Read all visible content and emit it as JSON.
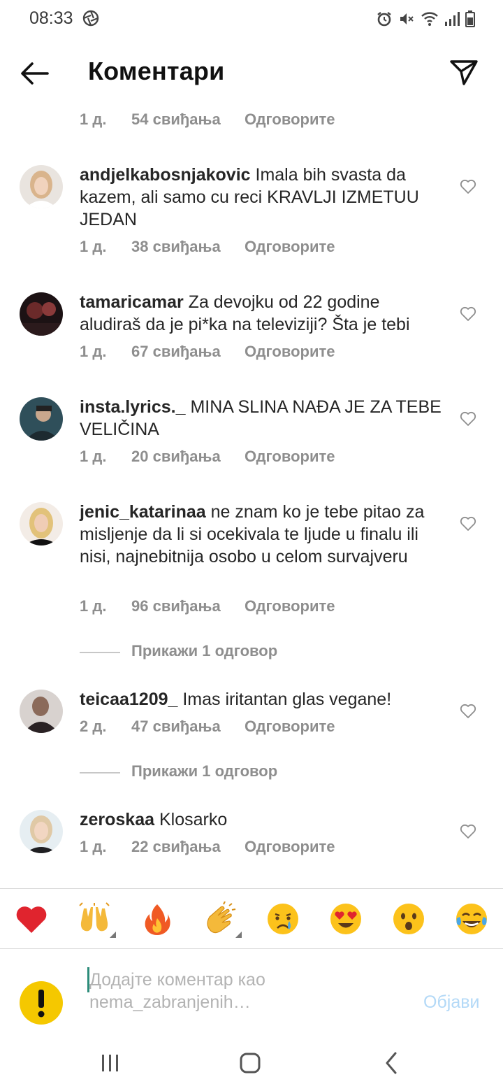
{
  "status_bar": {
    "time": "08:33",
    "left_icon": "aperture-icon",
    "right_icons": [
      "alarm-icon",
      "mute-icon",
      "wifi-icon",
      "signal-icon",
      "battery-icon"
    ]
  },
  "header": {
    "title": "Коментари",
    "back_icon": "back-arrow-icon",
    "share_icon": "paper-plane-icon"
  },
  "top_meta": {
    "time": "1 д.",
    "likes": "54 свиђања",
    "reply": "Одговорите"
  },
  "comments": [
    {
      "username": "andjelkabosnjakovic",
      "text": "Imala bih svasta da kazem, ali samo cu reci KRAVLJI IZMETUU JEDAN",
      "time": "1 д.",
      "likes": "38 свиђања",
      "reply": "Одговорите"
    },
    {
      "username": "tamaricamar",
      "text": "Za devojku od 22 godine aludiraš da je pi*ka na televiziji? Šta je tebi",
      "time": "1 д.",
      "likes": "67 свиђања",
      "reply": "Одговорите"
    },
    {
      "username": "insta.lyrics._",
      "text": "MINA SLINA NAĐA JE ZA TEBE VELIČINA",
      "time": "1 д.",
      "likes": "20 свиђања",
      "reply": "Одговорите"
    },
    {
      "username": "jenic_katarinaa",
      "text": "ne znam ko je tebe pitao za misljenje da li si ocekivala te ljude u finalu ili nisi, najnebitnija osobo u celom survajveru",
      "time": "1 д.",
      "likes": "96 свиђања",
      "reply": "Одговорите",
      "view_replies": "Прикажи 1 одговор"
    },
    {
      "username": "teicaa1209_",
      "text": "Imas iritantan glas vegane!",
      "time": "2 д.",
      "likes": "47 свиђања",
      "reply": "Одговорите",
      "view_replies": "Прикажи 1 одговор"
    },
    {
      "username": "zeroskaa",
      "text": "Klosarko",
      "time": "1 д.",
      "likes": "22 свиђања",
      "reply": "Одговорите"
    }
  ],
  "emoji_bar": [
    "red-heart",
    "raising-hands",
    "fire",
    "clapping-hands",
    "crying-face",
    "heart-eyes",
    "surprised-face",
    "tears-of-joy"
  ],
  "composer": {
    "placeholder": "Додајте коментар као nema_zabranjenih…",
    "post_label": "Објави",
    "avatar_icon": "exclamation-icon"
  },
  "nav_bar": [
    "recent-apps-icon",
    "home-icon",
    "back-icon"
  ],
  "colors": {
    "meta_gray": "#8e8e8e",
    "text": "#262626",
    "post_disabled": "#b3d9f7"
  }
}
